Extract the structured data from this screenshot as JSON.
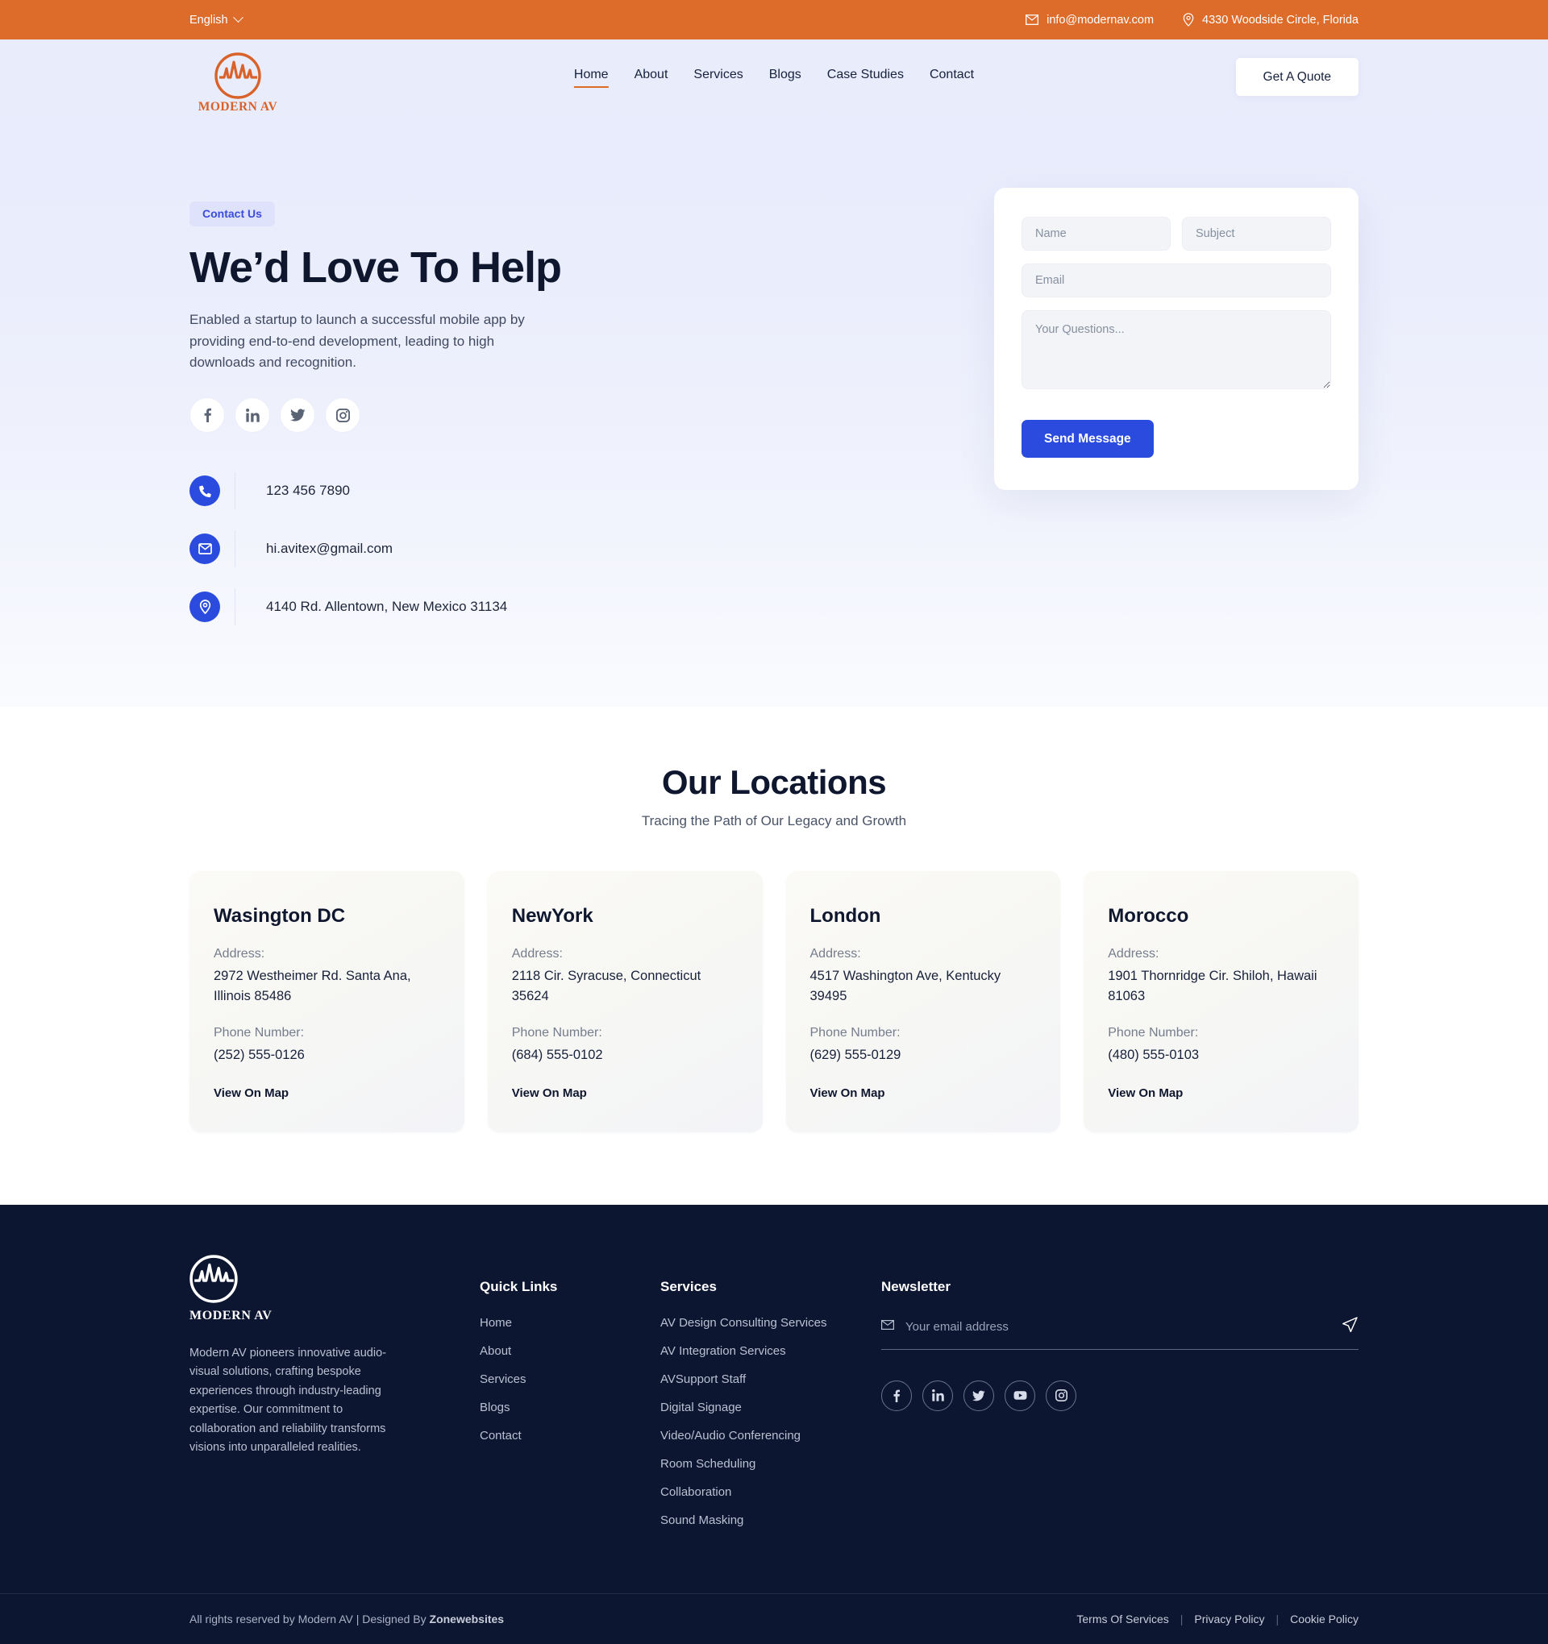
{
  "topbar": {
    "language": "English",
    "email": "info@modernav.com",
    "address": "4330 Woodside Circle, Florida",
    "email_icon": "mail-icon",
    "location_icon": "map-pin-icon"
  },
  "header": {
    "logo_text": "MODERN AV",
    "nav": [
      {
        "label": "Home",
        "active": true
      },
      {
        "label": "About",
        "active": false
      },
      {
        "label": "Services",
        "active": false
      },
      {
        "label": "Blogs",
        "active": false
      },
      {
        "label": "Case Studies",
        "active": false
      },
      {
        "label": "Contact",
        "active": false
      }
    ],
    "cta_label": "Get A Quote"
  },
  "hero": {
    "badge": "Contact Us",
    "title": "We’d Love To Help",
    "description": "Enabled a startup to launch a successful mobile app by providing end-to-end development, leading to high downloads and recognition.",
    "socials": [
      "facebook-icon",
      "linkedin-icon",
      "twitter-icon",
      "instagram-icon"
    ],
    "contacts": [
      {
        "icon": "phone-icon",
        "value": "123 456 7890"
      },
      {
        "icon": "mail-icon",
        "value": "hi.avitex@gmail.com"
      },
      {
        "icon": "map-pin-icon",
        "value": "4140 Rd. Allentown, New Mexico 31134"
      }
    ]
  },
  "form": {
    "name_placeholder": "Name",
    "subject_placeholder": "Subject",
    "email_placeholder": "Email",
    "questions_placeholder": "Your Questions...",
    "submit_label": "Send Message",
    "accent_color": "#2a4bde"
  },
  "locations": {
    "title": "Our Locations",
    "subtitle": "Tracing the Path of Our Legacy and Growth",
    "address_label": "Address:",
    "phone_label": "Phone Number:",
    "map_link_label": "View On Map",
    "cards": [
      {
        "city": "Wasington DC",
        "address": "2972 Westheimer Rd. Santa Ana, Illinois 85486",
        "phone": "(252) 555-0126"
      },
      {
        "city": "NewYork",
        "address": "2118 Cir. Syracuse, Connecticut 35624",
        "phone": "(684) 555-0102"
      },
      {
        "city": "London",
        "address": "4517 Washington Ave, Kentucky 39495",
        "phone": "(629) 555-0129"
      },
      {
        "city": "Morocco",
        "address": "1901 Thornridge Cir. Shiloh, Hawaii 81063",
        "phone": "(480) 555-0103"
      }
    ]
  },
  "footer": {
    "logo_text": "MODERN AV",
    "about": "Modern AV pioneers innovative audio-visual solutions, crafting bespoke experiences through industry-leading expertise. Our commitment to collaboration and reliability transforms visions into unparalleled realities.",
    "quick_links": {
      "title": "Quick Links",
      "items": [
        "Home",
        "About",
        "Services",
        "Blogs",
        "Contact"
      ]
    },
    "services": {
      "title": "Services",
      "items": [
        "AV Design Consulting Services",
        "AV Integration Services",
        "AVSupport Staff",
        "Digital Signage",
        "Video/Audio Conferencing",
        "Room Scheduling",
        "Collaboration",
        "Sound Masking"
      ]
    },
    "newsletter": {
      "title": "Newsletter",
      "placeholder": "Your email address",
      "mail_icon": "mail-icon",
      "send_icon": "paper-plane-icon",
      "socials": [
        "facebook-icon",
        "linkedin-icon",
        "twitter-icon",
        "youtube-icon",
        "instagram-icon"
      ]
    },
    "bottom": {
      "copyright_prefix": "All rights reserved by Modern AV | Designed By ",
      "designer": "Zonewebsites",
      "links": [
        "Terms Of Services",
        "Privacy Policy",
        "Cookie Policy"
      ],
      "separator": "|"
    }
  },
  "colors": {
    "top_bar": "#dd6b2a",
    "brand_orange": "#d9622a",
    "primary_blue": "#2a4bde",
    "footer_bg": "#0d1630"
  }
}
